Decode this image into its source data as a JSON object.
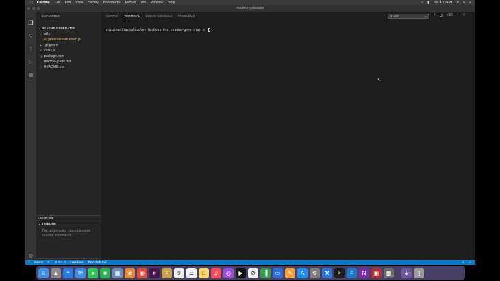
{
  "menubar": {
    "app_name": "Chrome",
    "items": [
      "File",
      "Edit",
      "View",
      "History",
      "Bookmarks",
      "People",
      "Tab",
      "Window",
      "Help"
    ],
    "clock": "Sat 4:19 PM"
  },
  "window": {
    "title": "readme-generator"
  },
  "sidebar": {
    "title": "EXPLORER",
    "project": "README-GENERATOR",
    "tree": [
      {
        "label": "utils",
        "kind": "folder",
        "indent": 1,
        "color": "#cccccc"
      },
      {
        "label": "generateMarkdown.js",
        "kind": "js",
        "indent": 2,
        "color": "#e5c07b"
      },
      {
        "label": ".gitignore",
        "kind": "git",
        "indent": 1,
        "color": "#cccccc"
      },
      {
        "label": "index.js",
        "kind": "js",
        "indent": 1,
        "color": "#cccccc"
      },
      {
        "label": "package.json",
        "kind": "json",
        "indent": 1,
        "color": "#cccccc"
      },
      {
        "label": "readme-guide.md",
        "kind": "md",
        "indent": 1,
        "color": "#cccccc"
      },
      {
        "label": "README.md",
        "kind": "info",
        "indent": 1,
        "color": "#cccccc"
      }
    ],
    "outline": "OUTLINE",
    "timeline": "TIMELINE",
    "timeline_message": "The active editor cannot provide timeline information.",
    "npm_scripts": "NPM SCRIPTS"
  },
  "panel": {
    "tabs": [
      "OUTPUT",
      "TERMINAL",
      "DEBUG CONSOLE",
      "PROBLEMS"
    ],
    "active_tab": "TERMINAL",
    "terminal_select": "1: zsh",
    "prompt": "nicolewallace@Nicoles-MacBook-Pro readme-generator % "
  },
  "statusbar": {
    "branch": "master",
    "problems": "⊗ 0 ⚠ 0",
    "lint": "markdown",
    "file": "README.md"
  },
  "dock": {
    "icons": [
      {
        "name": "finder-icon",
        "color": "#3d8fe0",
        "glyph": "☺"
      },
      {
        "name": "launchpad-icon",
        "color": "#8a8a8a",
        "glyph": "▲"
      },
      {
        "name": "safari-icon",
        "color": "#2a7de1",
        "glyph": "⌖"
      },
      {
        "name": "mail-icon",
        "color": "#3a8ee6",
        "glyph": "✉"
      },
      {
        "name": "messages-icon",
        "color": "#34c759",
        "glyph": "●"
      },
      {
        "name": "facetime-icon",
        "color": "#2bb24c",
        "glyph": "■"
      },
      {
        "name": "preview-icon",
        "color": "#6a8fb3",
        "glyph": "▦"
      },
      {
        "name": "photos-icon",
        "color": "#e58a3a",
        "glyph": "❀"
      },
      {
        "name": "chrome-icon",
        "color": "#dd4b39",
        "glyph": "◉"
      },
      {
        "name": "slack-icon",
        "color": "#4a154b",
        "glyph": "#"
      },
      {
        "name": "notes-icon",
        "color": "#c6a34a",
        "glyph": "≡"
      },
      {
        "name": "calendar-icon",
        "color": "#eeeeee",
        "glyph": "9"
      },
      {
        "name": "reminders-icon",
        "color": "#f2f2f2",
        "glyph": "☰"
      },
      {
        "name": "stickies-icon",
        "color": "#f5d76e",
        "glyph": "□"
      },
      {
        "name": "music-icon",
        "color": "#fa4b5c",
        "glyph": "♫"
      },
      {
        "name": "podcasts-icon",
        "color": "#9c4ddb",
        "glyph": "◎"
      },
      {
        "name": "tv-icon",
        "color": "#111111",
        "glyph": "▶"
      },
      {
        "name": "news-icon",
        "color": "#f2f2f2",
        "glyph": "⊘"
      },
      {
        "name": "numbers-icon",
        "color": "#30a04a",
        "glyph": "▐"
      },
      {
        "name": "keynote-icon",
        "color": "#2c6fd8",
        "glyph": "▭"
      },
      {
        "name": "pages-icon",
        "color": "#f0a13a",
        "glyph": "✎"
      },
      {
        "name": "app-store-icon",
        "color": "#1d8ff5",
        "glyph": "A"
      },
      {
        "name": "system-preferences-icon",
        "color": "#7d7d7d",
        "glyph": "⚙"
      },
      {
        "name": "xcode-icon",
        "color": "#2a78d6",
        "glyph": "⚒"
      },
      {
        "name": "terminal-icon",
        "color": "#1b1b1b",
        "glyph": ">"
      },
      {
        "name": "vscode-icon",
        "color": "#1f78c8",
        "glyph": "≡"
      },
      {
        "name": "onenote-icon",
        "color": "#7b2fa7",
        "glyph": "N"
      },
      {
        "name": "photo-booth-icon",
        "color": "#b03030",
        "glyph": "▣"
      },
      {
        "name": "screenshot-icon",
        "color": "#6d6d6d",
        "glyph": "▩"
      },
      {
        "name": "downloads-icon",
        "color": "#6b5a9a",
        "glyph": "⇣"
      },
      {
        "name": "trash-icon",
        "color": "#9a9a9a",
        "glyph": "▯"
      }
    ]
  }
}
